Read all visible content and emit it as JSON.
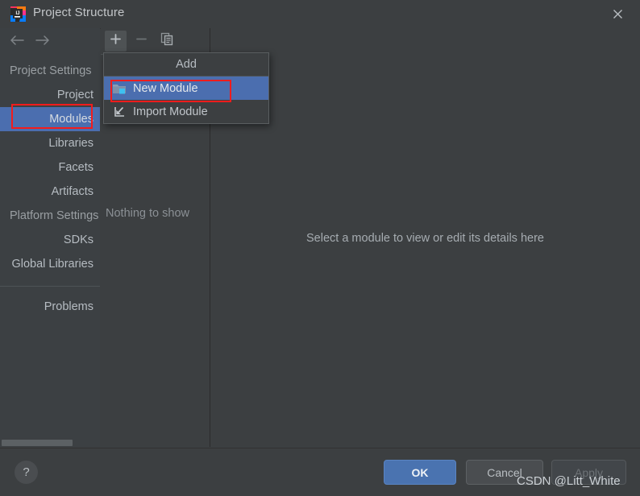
{
  "window": {
    "title": "Project Structure",
    "logo_icon": "intellij-idea-logo",
    "close_icon": "close-icon"
  },
  "sidebar": {
    "back_icon": "arrow-left-icon",
    "forward_icon": "arrow-right-icon",
    "groups": [
      {
        "label": "Project Settings",
        "items": [
          {
            "label": "Project",
            "selected": false
          },
          {
            "label": "Modules",
            "selected": true
          },
          {
            "label": "Libraries",
            "selected": false
          },
          {
            "label": "Facets",
            "selected": false
          },
          {
            "label": "Artifacts",
            "selected": false
          }
        ]
      },
      {
        "label": "Platform Settings",
        "items": [
          {
            "label": "SDKs",
            "selected": false
          },
          {
            "label": "Global Libraries",
            "selected": false
          }
        ]
      }
    ],
    "extra_items": [
      {
        "label": "Problems",
        "selected": false
      }
    ]
  },
  "module_pane": {
    "toolbar": {
      "add_icon": "plus-icon",
      "remove_icon": "minus-icon",
      "copy_icon": "copy-icon"
    },
    "empty_text": "Nothing to show"
  },
  "detail_pane": {
    "message": "Select a module to view or edit its details here"
  },
  "popup_menu": {
    "header": "Add",
    "items": [
      {
        "label": "New Module",
        "icon": "new-module-folder-icon",
        "highlighted": true
      },
      {
        "label": "Import Module",
        "icon": "import-module-arrow-icon",
        "highlighted": false
      }
    ]
  },
  "footer": {
    "help_label": "?",
    "buttons": [
      {
        "label": "OK",
        "style": "primary"
      },
      {
        "label": "Cancel",
        "style": "normal"
      },
      {
        "label": "Apply",
        "style": "disabled"
      }
    ]
  },
  "watermark": {
    "text": "CSDN @Litt_White"
  },
  "colors": {
    "window_bg": "#3c3f41",
    "sidebar_bg": "#3c4043",
    "selection_blue": "#4b6eaf",
    "primary_button": "#4a73b0",
    "annotation_red": "#f31c1c",
    "text_primary": "#b6bcc2",
    "text_muted": "#8b9095"
  }
}
